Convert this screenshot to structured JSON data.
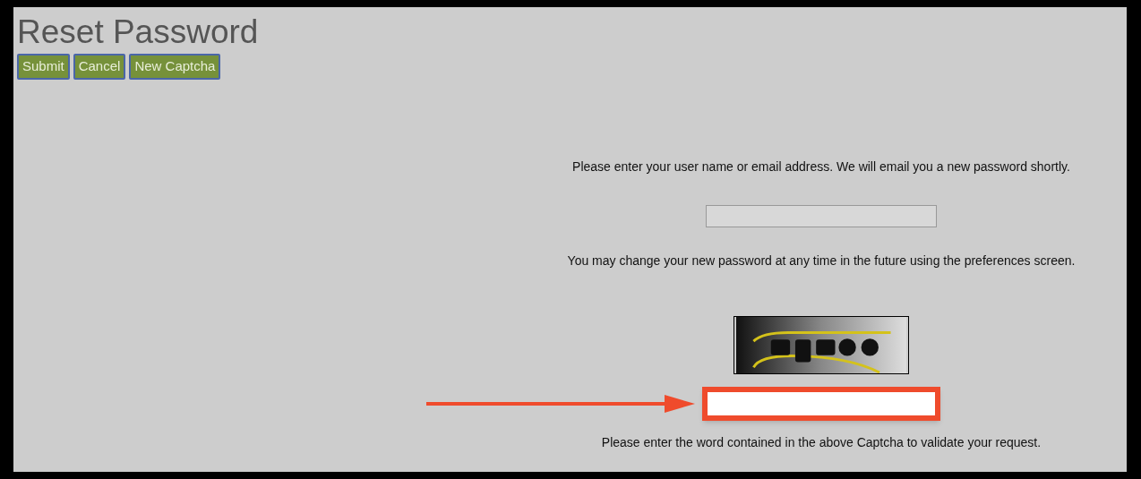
{
  "title": "Reset Password",
  "buttons": [
    "Submit",
    "Cancel",
    "New Captcha"
  ],
  "instructions": "Please enter your user name or email address. We will email you a new password shortly.",
  "note": "You may change your new password at any time in the future using the preferences screen.",
  "captcha_field": {
    "highlighted": true
  },
  "captcha_hint": "Please enter the word contained in the above Captcha to validate your request."
}
